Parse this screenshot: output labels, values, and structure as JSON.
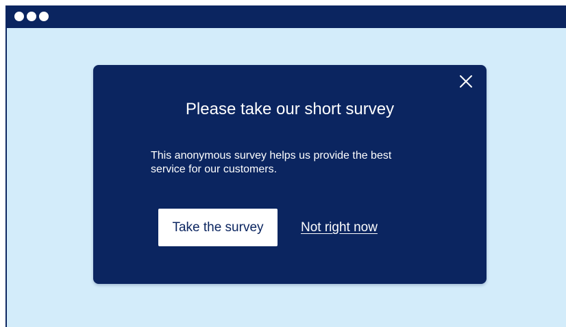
{
  "window": {
    "controls": [
      "window-dot",
      "window-dot",
      "window-dot"
    ]
  },
  "modal": {
    "title": "Please take our short survey",
    "description": "This anonymous survey helps us provide the best service for our customers.",
    "primary_button_label": "Take the survey",
    "secondary_link_label": "Not right now",
    "close_icon": "close-icon"
  },
  "colors": {
    "page_background": "#d3ecfa",
    "navy": "#0b2560",
    "white": "#ffffff"
  }
}
